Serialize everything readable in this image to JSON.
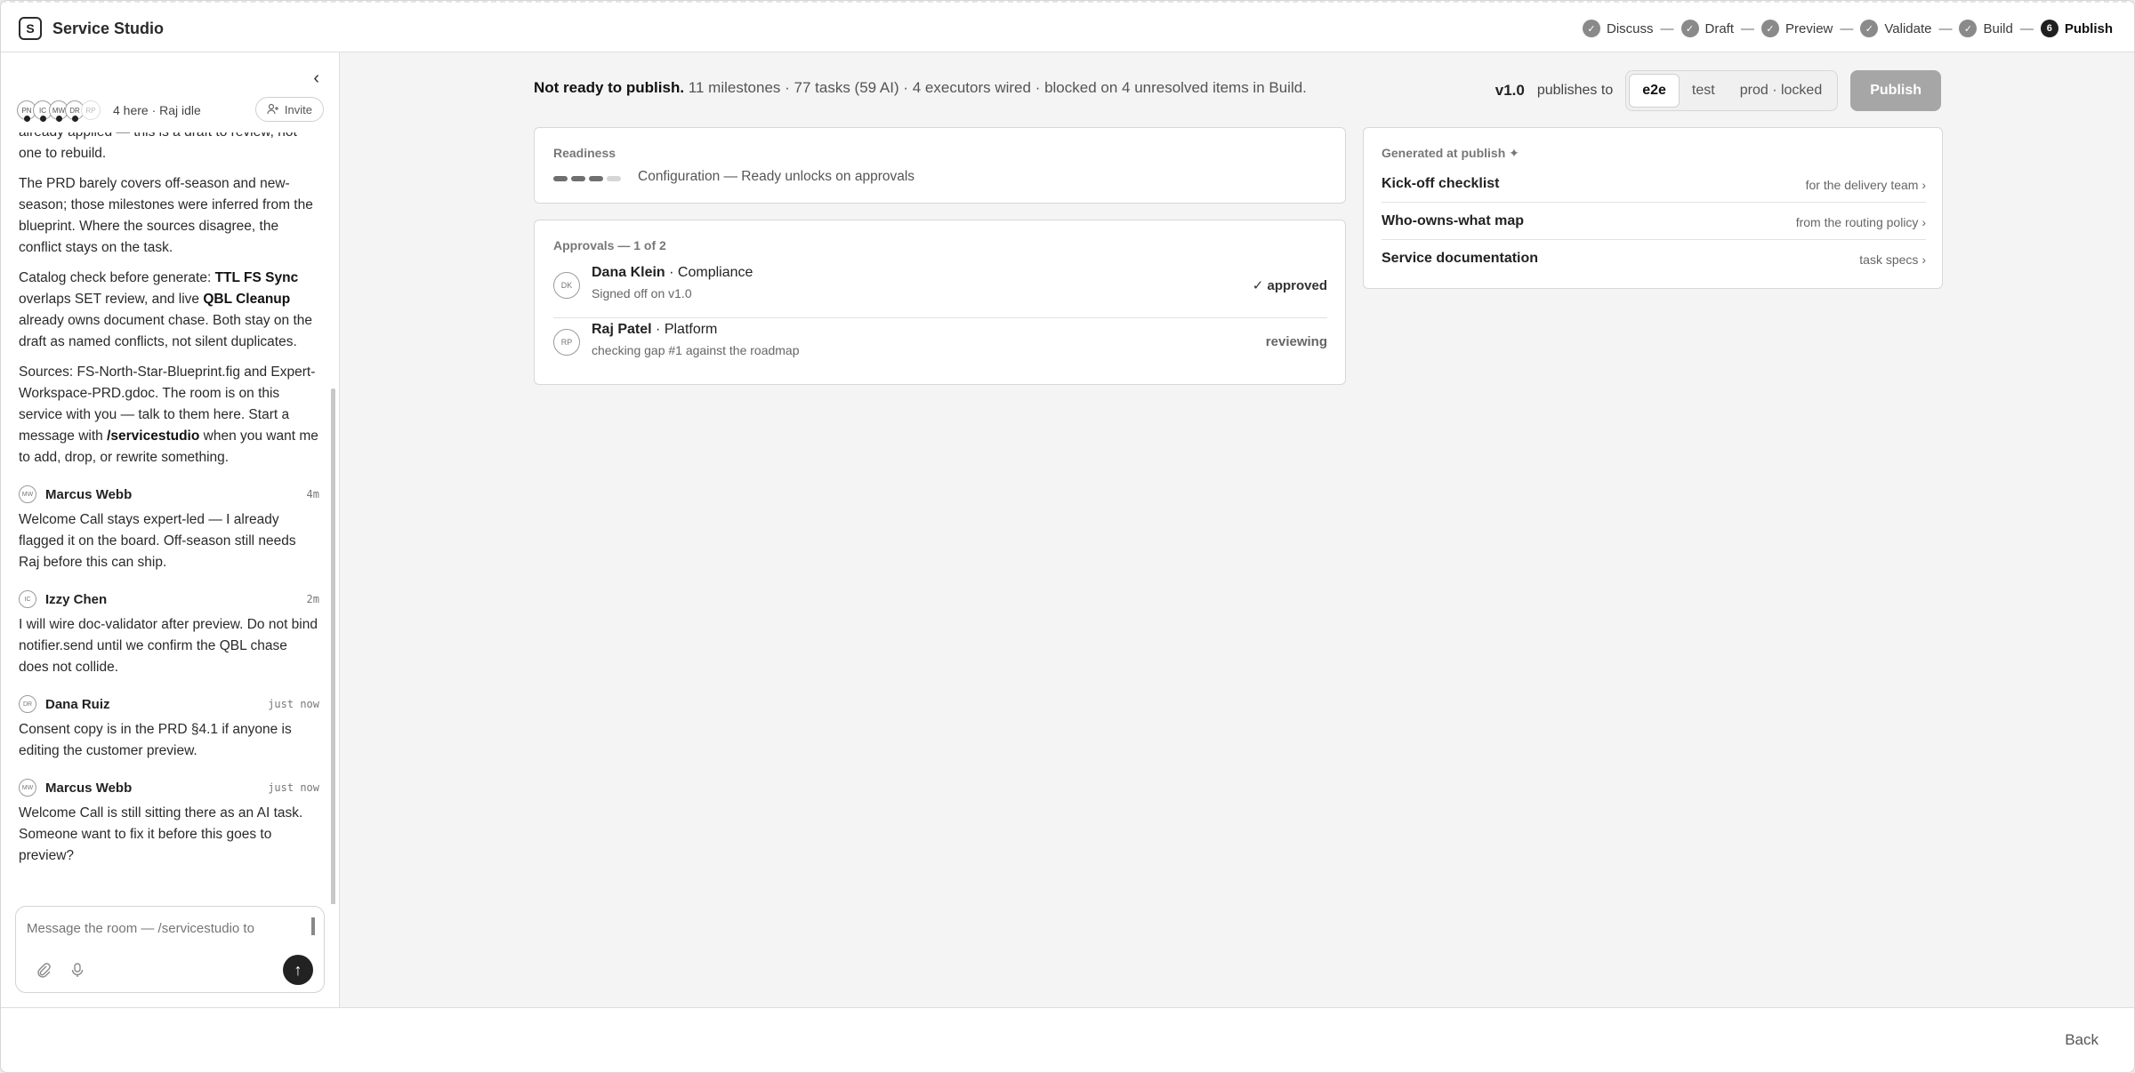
{
  "app": {
    "logo_letter": "S",
    "title": "Service Studio"
  },
  "steps": [
    {
      "label": "Discuss",
      "mark": "✓"
    },
    {
      "label": "Draft",
      "mark": "✓"
    },
    {
      "label": "Preview",
      "mark": "✓"
    },
    {
      "label": "Validate",
      "mark": "✓"
    },
    {
      "label": "Build",
      "mark": "✓"
    },
    {
      "label": "Publish",
      "mark": "6"
    }
  ],
  "step_separator": "—",
  "sidebar": {
    "collapse_icon": "‹",
    "avatars": [
      "PN",
      "IC",
      "MW",
      "DR",
      "RP"
    ],
    "presence_text": "4 here · Raj idle",
    "invite_label": "Invite",
    "paragraphs": [
      {
        "segments": [
          {
            "t": "already applied — this is a draft to review, not one to rebuild."
          }
        ]
      },
      {
        "segments": [
          {
            "t": "The PRD barely covers off-season and new-season; those milestones were inferred from the blueprint. Where the sources disagree, the conflict stays on the task."
          }
        ]
      },
      {
        "segments": [
          {
            "t": "Catalog check before generate: "
          },
          {
            "t": "TTL FS Sync",
            "b": true
          },
          {
            "t": " overlaps SET review, and live "
          },
          {
            "t": "QBL Cleanup",
            "b": true
          },
          {
            "t": " already owns document chase. Both stay on the draft as named conflicts, not silent duplicates."
          }
        ]
      },
      {
        "segments": [
          {
            "t": "Sources: FS-North-Star-Blueprint.fig and Expert-Workspace-PRD.gdoc. The room is on this service with you — talk to them here. Start a message with "
          },
          {
            "t": "/servicestudio",
            "b": true
          },
          {
            "t": " when you want me to add, drop, or rewrite something."
          }
        ]
      }
    ],
    "messages": [
      {
        "initials": "MW",
        "name": "Marcus Webb",
        "time": "4m",
        "body": "Welcome Call stays expert-led — I already flagged it on the board. Off-season still needs Raj before this can ship."
      },
      {
        "initials": "IC",
        "name": "Izzy Chen",
        "time": "2m",
        "body": "I will wire doc-validator after preview. Do not bind notifier.send until we confirm the QBL chase does not collide."
      },
      {
        "initials": "DR",
        "name": "Dana Ruiz",
        "time": "just now",
        "body": "Consent copy is in the PRD §4.1 if anyone is editing the customer preview."
      },
      {
        "initials": "MW",
        "name": "Marcus Webb",
        "time": "just now",
        "body": "Welcome Call is still sitting there as an AI task. Someone want to fix it before this goes to preview?"
      }
    ],
    "composer": {
      "placeholder": "Message the room — /servicestudio to",
      "attach_icon": "⊘",
      "mic_icon": "♪",
      "send_icon": "↑"
    }
  },
  "main": {
    "status_bold": "Not ready to publish.",
    "status_rest": " 11 milestones · 77 tasks (59 AI) · 4 executors wired · blocked on 4 unresolved items in Build.",
    "version": "v1.0",
    "publishes_to": "publishes to",
    "environments": [
      {
        "label": "e2e",
        "active": true
      },
      {
        "label": "test",
        "active": false
      },
      {
        "label": "prod · locked",
        "active": false
      }
    ],
    "publish_label": "Publish",
    "readiness": {
      "label": "Readiness",
      "segments_filled": 3,
      "segments_total": 4,
      "text": "Configuration — Ready unlocks on approvals"
    },
    "approvals": {
      "label": "Approvals — 1 of 2",
      "rows": [
        {
          "initials": "DK",
          "name": "Dana Klein",
          "role": " · Compliance",
          "sub": "Signed off on v1.0",
          "status": "✓ approved"
        },
        {
          "initials": "RP",
          "name": "Raj Patel",
          "role": " · Platform",
          "sub": "checking gap #1 against the roadmap",
          "status": "reviewing"
        }
      ]
    },
    "generated": {
      "label": "Generated at publish ✦",
      "rows": [
        {
          "title": "Kick-off checklist",
          "link": "for the delivery team ›"
        },
        {
          "title": "Who-owns-what map",
          "link": "from the routing policy ›"
        },
        {
          "title": "Service documentation",
          "link": "task specs ›"
        }
      ]
    }
  },
  "footer": {
    "back_label": "Back"
  }
}
